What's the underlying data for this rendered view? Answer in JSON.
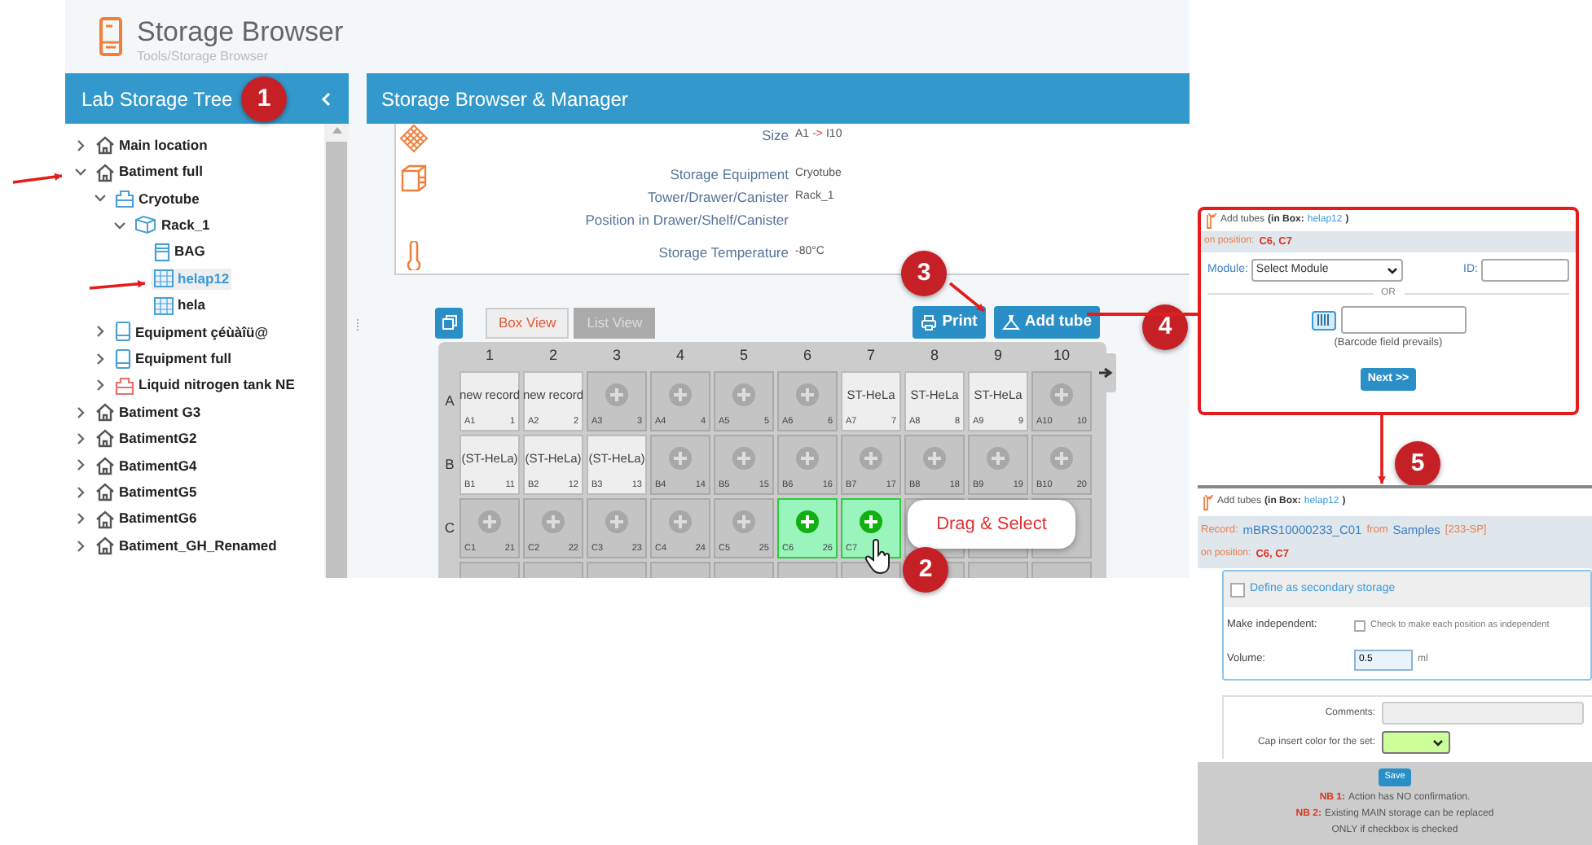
{
  "app": {
    "title": "Storage Browser",
    "breadcrumb": "Tools/Storage Browser"
  },
  "tree_panel": {
    "title": "Lab Storage Tree"
  },
  "tree": [
    {
      "label": "Main location",
      "kind": "building",
      "expanded": false,
      "selected": false
    },
    {
      "label": "Batiment full",
      "kind": "building",
      "expanded": true,
      "selected": false,
      "children": [
        {
          "label": "Cryotube",
          "kind": "cryo",
          "expanded": true,
          "selected": false,
          "children": [
            {
              "label": "Rack_1",
              "kind": "rack",
              "expanded": true,
              "selected": false,
              "children": [
                {
                  "label": "BAG",
                  "kind": "bag",
                  "selected": false
                },
                {
                  "label": "helap12",
                  "kind": "box",
                  "selected": true
                },
                {
                  "label": "hela",
                  "kind": "box",
                  "selected": false
                }
              ]
            }
          ]
        },
        {
          "label": "Equipment çéùàîü@",
          "kind": "equipment",
          "expanded": false,
          "selected": false
        },
        {
          "label": "Equipment full",
          "kind": "equipment",
          "expanded": false,
          "selected": false
        },
        {
          "label": "Liquid nitrogen tank NE",
          "kind": "tank",
          "expanded": false,
          "selected": false
        }
      ]
    },
    {
      "label": "Batiment G3",
      "kind": "building",
      "expanded": false,
      "selected": false
    },
    {
      "label": "BatimentG2",
      "kind": "building",
      "expanded": false,
      "selected": false
    },
    {
      "label": "BatimentG4",
      "kind": "building",
      "expanded": false,
      "selected": false
    },
    {
      "label": "BatimentG5",
      "kind": "building",
      "expanded": false,
      "selected": false
    },
    {
      "label": "BatimentG6",
      "kind": "building",
      "expanded": false,
      "selected": false
    },
    {
      "label": "Batiment_GH_Renamed",
      "kind": "building",
      "expanded": false,
      "selected": false
    }
  ],
  "manager": {
    "title": "Storage Browser & Manager",
    "info_groups": [
      {
        "kind": "grid",
        "rows": [
          {
            "label": "Size",
            "value": "A1",
            "arrow": "->",
            "value_to": "I10"
          }
        ]
      },
      {
        "kind": "drawer",
        "rows": [
          {
            "label": "Storage Equipment",
            "value": "Cryotube"
          },
          {
            "label": "Tower/Drawer/Canister",
            "value": "Rack_1"
          },
          {
            "label": "Position in Drawer/Shelf/Canister"
          }
        ]
      },
      {
        "kind": "thermometer",
        "rows": [
          {
            "label": "Storage Temperature",
            "value": "-80°C"
          }
        ]
      }
    ]
  },
  "view_tabs": [
    {
      "label": "Box View",
      "selected": true
    },
    {
      "label": "List View",
      "selected": false
    }
  ],
  "buttons": [
    {
      "label": "Print",
      "kind": "printer"
    },
    {
      "label": "Add tube",
      "kind": "tubes"
    }
  ],
  "grid": {
    "columns": [
      "1",
      "2",
      "3",
      "4",
      "5",
      "6",
      "7",
      "8",
      "9",
      "10"
    ],
    "rows": [
      {
        "label": "A",
        "cells": [
          {
            "kind": "filled",
            "content": "new record",
            "pos": "A1",
            "num": "1",
            "selected": false
          },
          {
            "kind": "filled",
            "content": "new record",
            "pos": "A2",
            "num": "2",
            "selected": false
          },
          {
            "kind": "empty",
            "pos": "A3",
            "num": "3",
            "selected": false
          },
          {
            "kind": "empty",
            "pos": "A4",
            "num": "4",
            "selected": false
          },
          {
            "kind": "empty",
            "pos": "A5",
            "num": "5",
            "selected": false
          },
          {
            "kind": "empty",
            "pos": "A6",
            "num": "6",
            "selected": false
          },
          {
            "kind": "filled",
            "content": "ST-HeLa",
            "pos": "A7",
            "num": "7",
            "selected": false
          },
          {
            "kind": "filled",
            "content": "ST-HeLa",
            "pos": "A8",
            "num": "8",
            "selected": false
          },
          {
            "kind": "filled",
            "content": "ST-HeLa",
            "pos": "A9",
            "num": "9",
            "selected": false
          },
          {
            "kind": "empty",
            "pos": "A10",
            "num": "10",
            "selected": false
          }
        ]
      },
      {
        "label": "B",
        "cells": [
          {
            "kind": "filled",
            "content": "(ST-HeLa)",
            "pos": "B1",
            "num": "11",
            "selected": false
          },
          {
            "kind": "filled",
            "content": "(ST-HeLa)",
            "pos": "B2",
            "num": "12",
            "selected": false
          },
          {
            "kind": "filled",
            "content": "(ST-HeLa)",
            "pos": "B3",
            "num": "13",
            "selected": false
          },
          {
            "kind": "empty",
            "pos": "B4",
            "num": "14",
            "selected": false
          },
          {
            "kind": "empty",
            "pos": "B5",
            "num": "15",
            "selected": false
          },
          {
            "kind": "empty",
            "pos": "B6",
            "num": "16",
            "selected": false
          },
          {
            "kind": "empty",
            "pos": "B7",
            "num": "17",
            "selected": false
          },
          {
            "kind": "empty",
            "pos": "B8",
            "num": "18",
            "selected": false
          },
          {
            "kind": "empty",
            "pos": "B9",
            "num": "19",
            "selected": false
          },
          {
            "kind": "empty",
            "pos": "B10",
            "num": "20",
            "selected": false
          }
        ]
      },
      {
        "label": "C",
        "cells": [
          {
            "kind": "empty",
            "pos": "C1",
            "num": "21",
            "selected": false
          },
          {
            "kind": "empty",
            "pos": "C2",
            "num": "22",
            "selected": false
          },
          {
            "kind": "empty",
            "pos": "C3",
            "num": "23",
            "selected": false
          },
          {
            "kind": "empty",
            "pos": "C4",
            "num": "24",
            "selected": false
          },
          {
            "kind": "empty",
            "pos": "C5",
            "num": "25",
            "selected": false
          },
          {
            "kind": "empty",
            "pos": "C6",
            "num": "26",
            "selected": true
          },
          {
            "kind": "empty",
            "pos": "C7",
            "selected": true
          },
          {
            "kind": "blank",
            "selected": false
          },
          {
            "kind": "blank",
            "selected": false
          },
          {
            "kind": "blank",
            "selected": false
          }
        ]
      },
      {
        "cells": [
          {
            "kind": "blank",
            "selected": false
          },
          {
            "kind": "blank",
            "selected": false
          },
          {
            "kind": "blank",
            "selected": false
          },
          {
            "kind": "blank",
            "selected": false
          },
          {
            "kind": "blank",
            "selected": false
          },
          {
            "kind": "blank",
            "selected": false
          },
          {
            "kind": "blank",
            "selected": false
          },
          {
            "kind": "blank",
            "selected": false
          },
          {
            "kind": "blank",
            "selected": false
          },
          {
            "kind": "blank",
            "selected": false
          }
        ]
      }
    ]
  },
  "callout": {
    "text": "Drag & Select"
  },
  "markers": [
    "1",
    "2",
    "3",
    "4",
    "5"
  ],
  "popup_module": {
    "title": "Add tubes",
    "box_prefix": "(in Box:",
    "box": "helap12",
    "box_suffix": ")",
    "position_label": "on position:",
    "positions": "C6, C7",
    "module_label": "Module:",
    "module_select": "Select Module",
    "id_label": "ID:",
    "or": "OR",
    "barcode_hint": "(Barcode field prevails)",
    "next": "Next >>"
  },
  "popup_details": {
    "title": "Add tubes",
    "box_prefix": "(in Box:",
    "box": "helap12",
    "box_suffix": ")",
    "record_label": "Record:",
    "record": "mBRS10000233_C01",
    "from": "from",
    "module": "Samples",
    "code": "[233-SP]",
    "position_label": "on position:",
    "positions": "C6, C7",
    "secondary": {
      "label": "Define as secondary storage",
      "checked": false
    },
    "independent": {
      "label": "Make independent:",
      "hint": "Check to make each position as independent",
      "checked": false
    },
    "volume": {
      "label": "Volume:",
      "value": "0.5",
      "unit": "ml"
    },
    "comments_label": "Comments:",
    "cap_label": "Cap insert color for the set:",
    "save": "Save",
    "notes": [
      {
        "label": "NB 1:",
        "text": "Action has NO confirmation."
      },
      {
        "label": "NB 2:",
        "text": "Existing MAIN storage can be replaced"
      },
      {
        "text": "ONLY if checkbox is checked"
      }
    ]
  }
}
